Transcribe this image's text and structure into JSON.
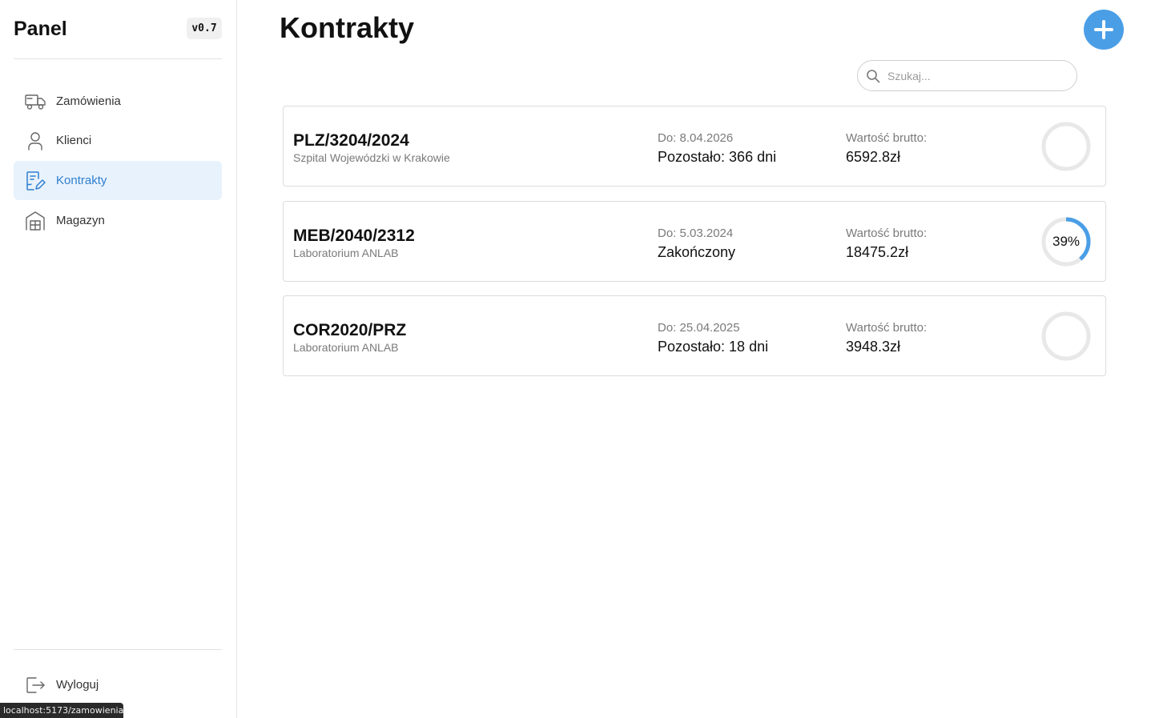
{
  "sidebar": {
    "brand": "Panel",
    "version": "v0.7",
    "items": [
      {
        "label": "Zamówienia",
        "icon": "truck-icon",
        "active": false
      },
      {
        "label": "Klienci",
        "icon": "user-icon",
        "active": false
      },
      {
        "label": "Kontrakty",
        "icon": "contract-edit-icon",
        "active": true
      },
      {
        "label": "Magazyn",
        "icon": "warehouse-icon",
        "active": false
      }
    ],
    "logout": {
      "label": "Wyloguj",
      "icon": "logout-icon"
    }
  },
  "status_bar": {
    "url": "localhost:5173/zamowienia"
  },
  "main": {
    "title": "Kontrakty",
    "add_icon": "plus-icon",
    "search": {
      "placeholder": "Szukaj...",
      "value": "",
      "icon": "search-icon"
    }
  },
  "contracts": [
    {
      "code": "PLZ/3204/2024",
      "client": "Szpital Wojewódzki w Krakowie",
      "due": "Do: 8.04.2026",
      "status": "Pozostało: 366 dni",
      "value_label": "Wartość brutto:",
      "value": "6592.8zł",
      "progress": 0,
      "progress_text": ""
    },
    {
      "code": "MEB/2040/2312",
      "client": "Laboratorium ANLAB",
      "due": "Do: 5.03.2024",
      "status": "Zakończony",
      "value_label": "Wartość brutto:",
      "value": "18475.2zł",
      "progress": 0.39,
      "progress_text": "39%"
    },
    {
      "code": "COR2020/PRZ",
      "client": "Laboratorium ANLAB",
      "due": "Do: 25.04.2025",
      "status": "Pozostało: 18 dni",
      "value_label": "Wartość brutto:",
      "value": "3948.3zł",
      "progress": 0,
      "progress_text": ""
    }
  ],
  "colors": {
    "accent": "#2e7fcf",
    "accent_button": "#4a9ee6",
    "active_bg": "#e8f2fc",
    "progress_track": "#e8e8e8",
    "progress_fill": "#4a9ee6"
  }
}
